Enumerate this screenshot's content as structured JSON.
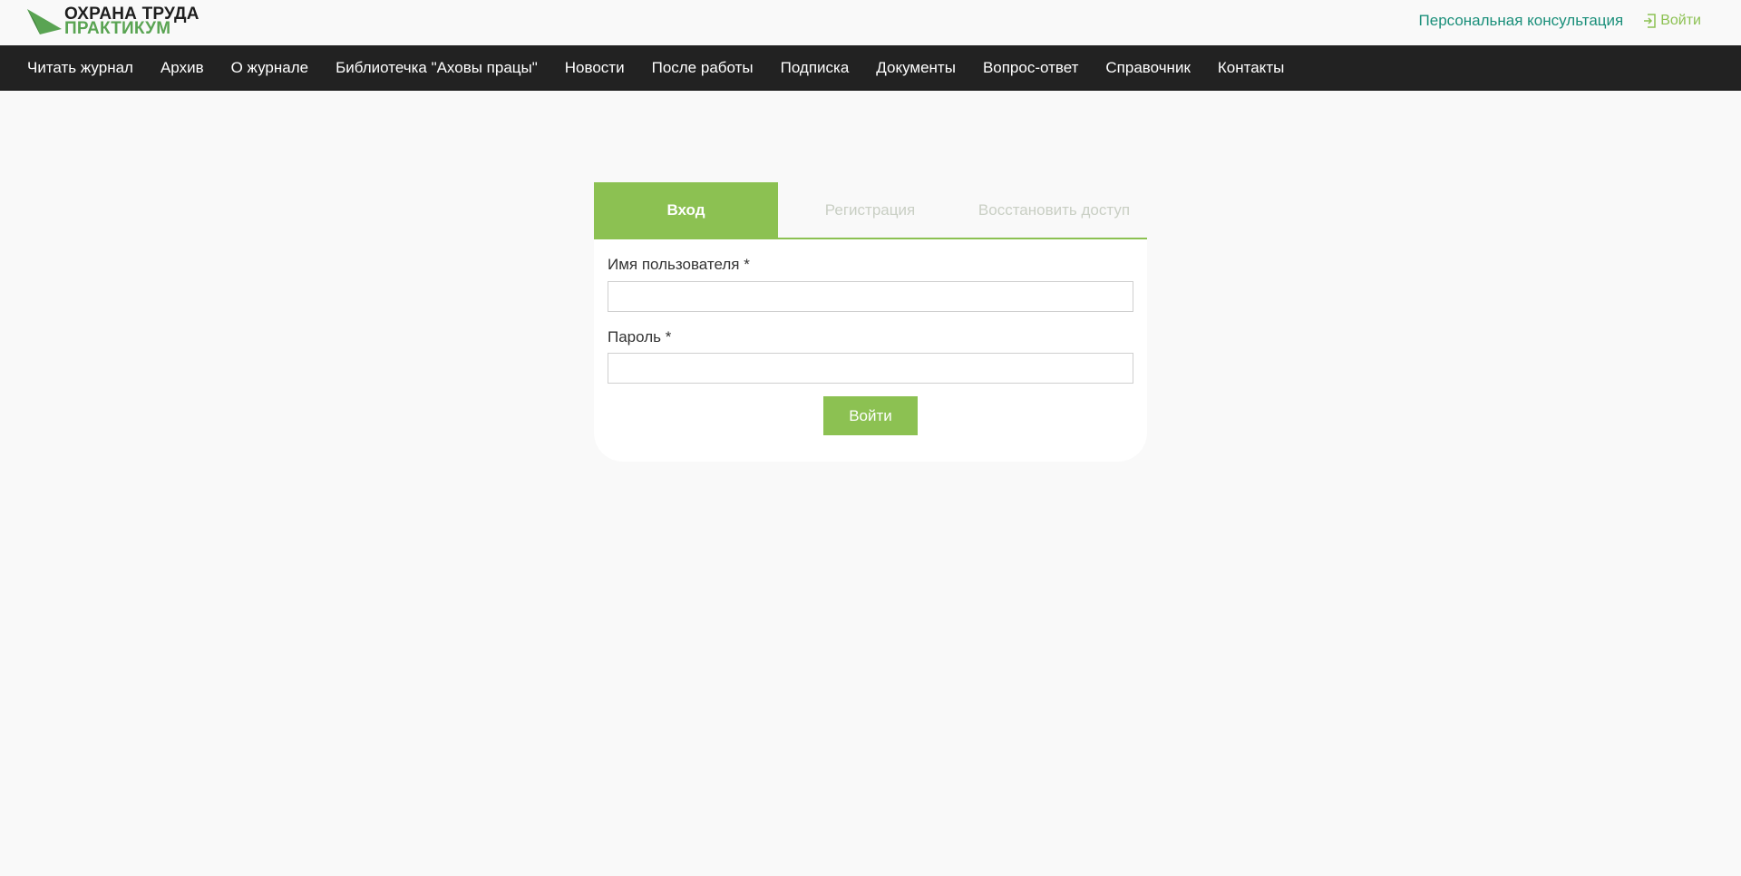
{
  "header": {
    "logo_line1": "ОХРАНА ТРУДА",
    "logo_line2": "ПРАКТИКУМ",
    "consultation_link": "Персональная консультация",
    "login_link": "Войти"
  },
  "nav": {
    "items": [
      {
        "label": "Читать журнал"
      },
      {
        "label": "Архив"
      },
      {
        "label": "О журнале"
      },
      {
        "label": "Библиотечка \"Аховы працы\""
      },
      {
        "label": "Новости"
      },
      {
        "label": "После работы"
      },
      {
        "label": "Подписка"
      },
      {
        "label": "Документы"
      },
      {
        "label": "Вопрос-ответ"
      },
      {
        "label": "Справочник"
      },
      {
        "label": "Контакты"
      }
    ]
  },
  "auth": {
    "tabs": [
      {
        "label": "Вход",
        "active": true
      },
      {
        "label": "Регистрация",
        "active": false
      },
      {
        "label": "Восстановить доступ",
        "active": false
      }
    ],
    "username_label": "Имя пользователя *",
    "username_value": "",
    "password_label": "Пароль *",
    "password_value": "",
    "submit_label": "Войти"
  },
  "colors": {
    "accent_green": "#8cc152",
    "logo_green": "#5aa453",
    "link_teal": "#1a8f7a",
    "nav_bg": "#222222"
  },
  "icons": {
    "logo": "green-paper-plane-icon",
    "login": "sign-in-icon"
  }
}
